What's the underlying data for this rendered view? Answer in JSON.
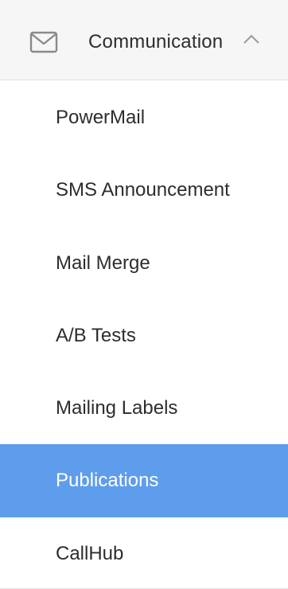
{
  "section": {
    "title": "Communication",
    "icon": "mail-icon",
    "toggle_icon": "chevron-up-icon",
    "expanded": true
  },
  "menu": {
    "items": [
      {
        "label": "PowerMail",
        "active": false
      },
      {
        "label": "SMS Announcement",
        "active": false
      },
      {
        "label": "Mail Merge",
        "active": false
      },
      {
        "label": "A/B Tests",
        "active": false
      },
      {
        "label": "Mailing Labels",
        "active": false
      },
      {
        "label": "Publications",
        "active": true
      },
      {
        "label": "CallHub",
        "active": false
      }
    ]
  },
  "colors": {
    "active_background": "#5e9deb",
    "header_background": "#f6f6f6",
    "text": "#2d2d2d",
    "icon": "#8a8a8a"
  }
}
